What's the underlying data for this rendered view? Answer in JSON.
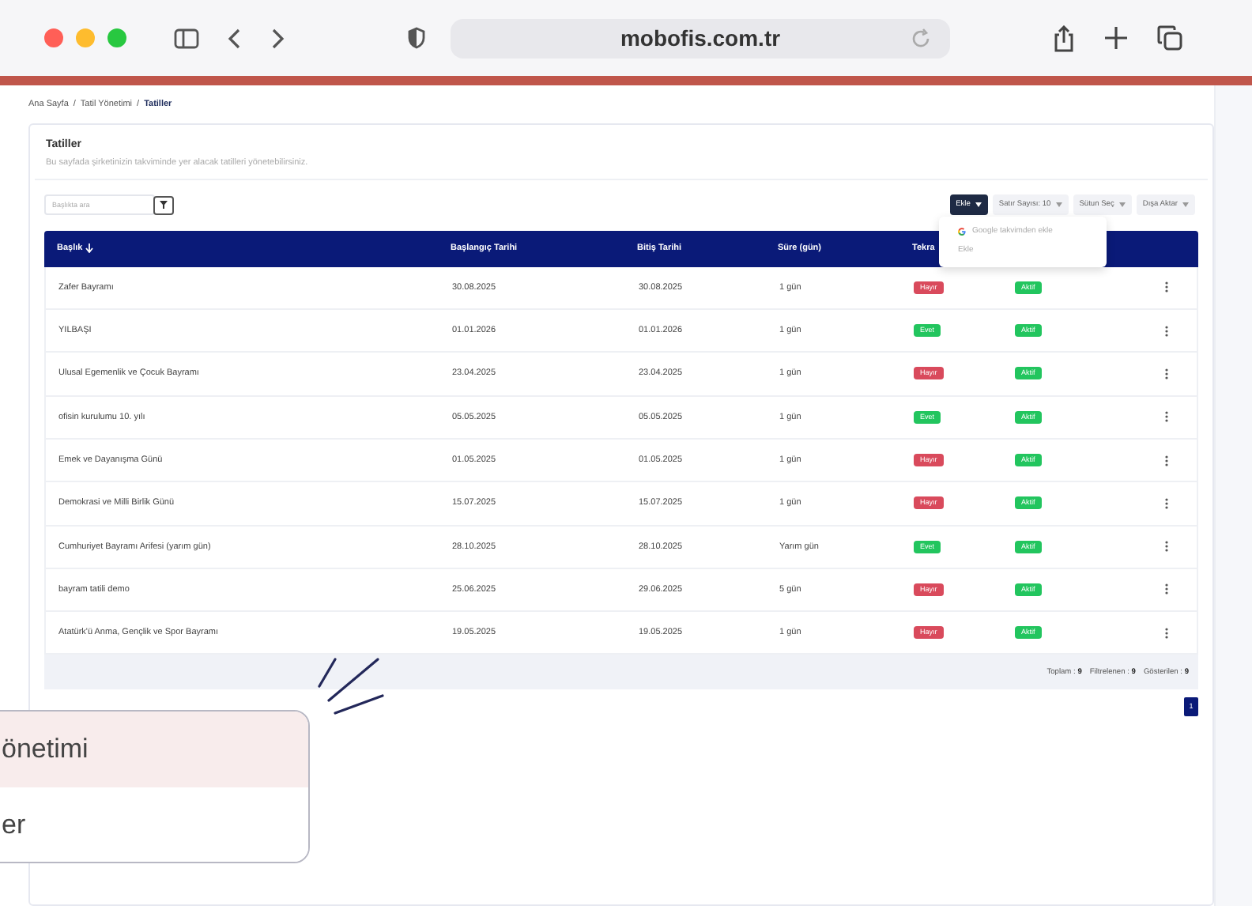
{
  "browser": {
    "url": "mobofis.com.tr"
  },
  "breadcrumb": {
    "separator": "/",
    "items": [
      {
        "label": "Ana Sayfa",
        "current": false
      },
      {
        "label": "Tatil Yönetimi",
        "current": false
      },
      {
        "label": "Tatiller",
        "current": true
      }
    ]
  },
  "page": {
    "title": "Tatiller",
    "subtitle": "Bu sayfada şirketinizin takviminde yer alacak tatilleri yönetebilirsiniz."
  },
  "search": {
    "placeholder": "Başlıkta ara"
  },
  "toolbar": [
    {
      "label": "Ekle",
      "primary": true
    },
    {
      "label": "Satır Sayısı: 10",
      "primary": false
    },
    {
      "label": "Sütun Seç",
      "primary": false
    },
    {
      "label": "Dışa Aktar",
      "primary": false
    }
  ],
  "dropdown": {
    "items": [
      {
        "label": "Google takvimden ekle",
        "kind": "google"
      },
      {
        "label": "Ekle",
        "kind": "plain"
      }
    ]
  },
  "table": {
    "columns": [
      {
        "label": "Başlık",
        "sorted": true
      },
      {
        "label": "Başlangıç Tarihi",
        "sorted": false
      },
      {
        "label": "Bitiş Tarihi",
        "sorted": false
      },
      {
        "label": "Süre (gün)",
        "sorted": false
      },
      {
        "label": "Tekra",
        "sorted": false
      }
    ],
    "rows": [
      {
        "title": "Zafer Bayramı",
        "start": "30.08.2025",
        "end": "30.08.2025",
        "duration": "1 gün",
        "recurring": {
          "label": "Hayır",
          "color": "#d94a5c"
        },
        "status": {
          "label": "Aktif",
          "color": "#22c55e"
        }
      },
      {
        "title": "YILBAŞI",
        "start": "01.01.2026",
        "end": "01.01.2026",
        "duration": "1 gün",
        "recurring": {
          "label": "Evet",
          "color": "#22c55e"
        },
        "status": {
          "label": "Aktif",
          "color": "#22c55e"
        }
      },
      {
        "title": "Ulusal Egemenlik ve Çocuk Bayramı",
        "start": "23.04.2025",
        "end": "23.04.2025",
        "duration": "1 gün",
        "recurring": {
          "label": "Hayır",
          "color": "#d94a5c"
        },
        "status": {
          "label": "Aktif",
          "color": "#22c55e"
        }
      },
      {
        "title": "ofisin kurulumu 10. yılı",
        "start": "05.05.2025",
        "end": "05.05.2025",
        "duration": "1 gün",
        "recurring": {
          "label": "Evet",
          "color": "#22c55e"
        },
        "status": {
          "label": "Aktif",
          "color": "#22c55e"
        }
      },
      {
        "title": "Emek ve Dayanışma Günü",
        "start": "01.05.2025",
        "end": "01.05.2025",
        "duration": "1 gün",
        "recurring": {
          "label": "Hayır",
          "color": "#d94a5c"
        },
        "status": {
          "label": "Aktif",
          "color": "#22c55e"
        }
      },
      {
        "title": "Demokrasi ve Milli Birlik Günü",
        "start": "15.07.2025",
        "end": "15.07.2025",
        "duration": "1 gün",
        "recurring": {
          "label": "Hayır",
          "color": "#d94a5c"
        },
        "status": {
          "label": "Aktif",
          "color": "#22c55e"
        }
      },
      {
        "title": "Cumhuriyet Bayramı Arifesi (yarım gün)",
        "start": "28.10.2025",
        "end": "28.10.2025",
        "duration": "Yarım gün",
        "recurring": {
          "label": "Evet",
          "color": "#22c55e"
        },
        "status": {
          "label": "Aktif",
          "color": "#22c55e"
        }
      },
      {
        "title": "bayram tatili demo",
        "start": "25.06.2025",
        "end": "29.06.2025",
        "duration": "5 gün",
        "recurring": {
          "label": "Hayır",
          "color": "#d94a5c"
        },
        "status": {
          "label": "Aktif",
          "color": "#22c55e"
        }
      },
      {
        "title": "Atatürk'ü Anma, Gençlik ve Spor Bayramı",
        "start": "19.05.2025",
        "end": "19.05.2025",
        "duration": "1 gün",
        "recurring": {
          "label": "Hayır",
          "color": "#d94a5c"
        },
        "status": {
          "label": "Aktif",
          "color": "#22c55e"
        }
      }
    ]
  },
  "footer": [
    {
      "label": "Toplam :",
      "value": "9"
    },
    {
      "label": "Filtrelenen :",
      "value": "9"
    },
    {
      "label": "Gösterilen :",
      "value": "9"
    }
  ],
  "pagination": [
    {
      "label": "1",
      "selected": true
    }
  ],
  "callout": {
    "lines": [
      {
        "text": "önetimi",
        "highlighted": true
      },
      {
        "text": "er",
        "highlighted": false
      }
    ]
  }
}
